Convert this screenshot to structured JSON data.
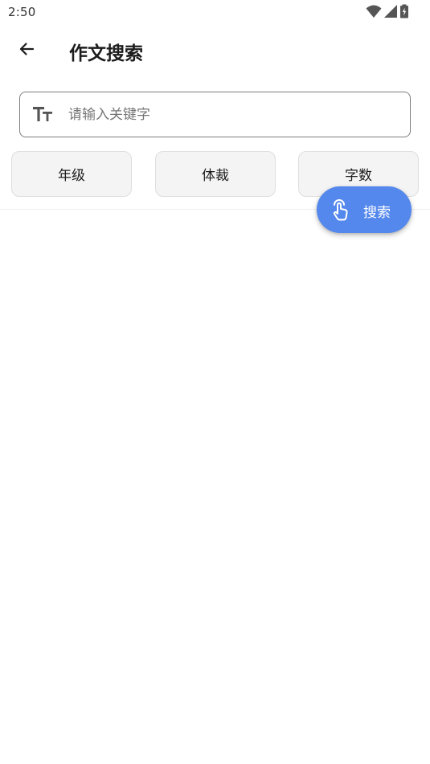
{
  "status_bar": {
    "time": "2:50",
    "icons": [
      "wifi-icon",
      "cellular-signal-icon",
      "battery-charging-icon"
    ]
  },
  "app_bar": {
    "back_icon": "arrow-left-icon",
    "title": "作文搜索"
  },
  "search": {
    "icon": "text-size-icon",
    "value": "",
    "placeholder": "请输入关键字"
  },
  "filters": [
    {
      "label": "年级"
    },
    {
      "label": "体裁"
    },
    {
      "label": "字数"
    }
  ],
  "fab": {
    "icon": "touch-hand-icon",
    "label": "搜索"
  },
  "colors": {
    "accent": "#5488ed",
    "chip_background": "#f4f4f4",
    "field_border": "#7d7d7d"
  }
}
